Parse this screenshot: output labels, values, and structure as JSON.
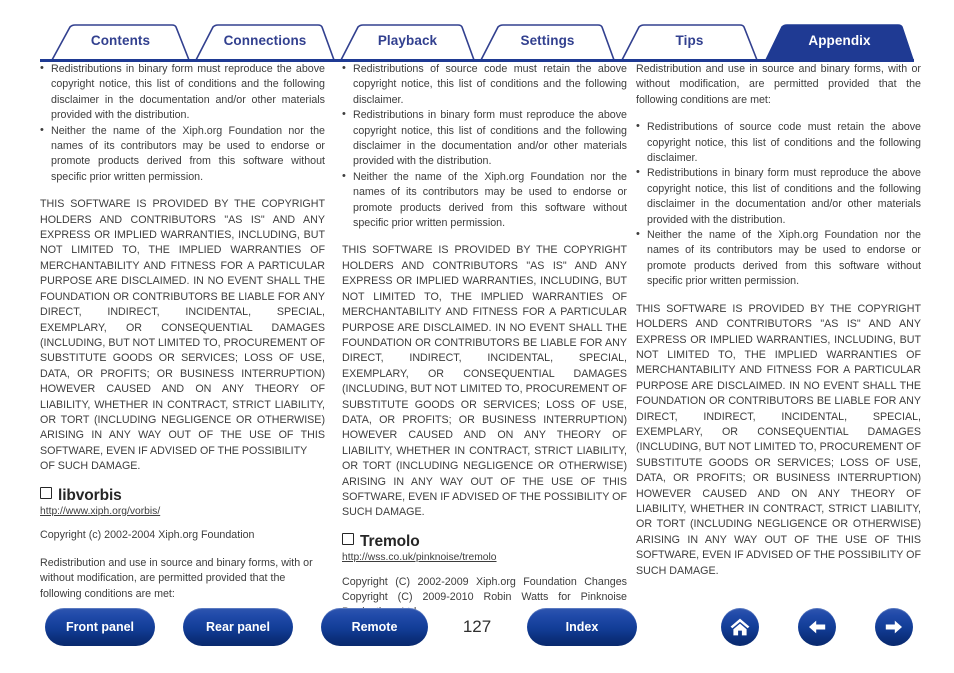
{
  "tabs": [
    {
      "label": "Contents",
      "active": false
    },
    {
      "label": "Connections",
      "active": false
    },
    {
      "label": "Playback",
      "active": false
    },
    {
      "label": "Settings",
      "active": false
    },
    {
      "label": "Tips",
      "active": false
    },
    {
      "label": "Appendix",
      "active": true
    }
  ],
  "colors": {
    "tab_text": "#32408f",
    "tab_active_bg": "#1f3a93",
    "tab_border": "#32408f",
    "button_blue": "#123d96",
    "body_text": "#3d3d3d"
  },
  "columns": {
    "col1": {
      "bullets_top": [
        "Redistributions in binary form must reproduce the above copyright notice, this list of conditions and the following disclaimer in the documentation and/or other materials provided with the distribution.",
        "Neither the name of the Xiph.org Foundation nor the names of its contributors may be used to endorse or promote products derived from this software without specific prior written permission."
      ],
      "disclaimer": "THIS SOFTWARE IS PROVIDED BY THE COPYRIGHT HOLDERS AND CONTRIBUTORS \"AS IS\" AND ANY EXPRESS OR IMPLIED WARRANTIES, INCLUDING, BUT NOT LIMITED TO, THE IMPLIED WARRANTIES OF MERCHANTABILITY AND FITNESS FOR A PARTICULAR PURPOSE ARE DISCLAIMED. IN NO EVENT SHALL THE FOUNDATION OR CONTRIBUTORS BE LIABLE FOR ANY DIRECT, INDIRECT, INCIDENTAL, SPECIAL, EXEMPLARY, OR CONSEQUENTIAL DAMAGES (INCLUDING, BUT NOT LIMITED TO, PROCUREMENT OF SUBSTITUTE GOODS OR SERVICES; LOSS OF USE, DATA, OR PROFITS; OR BUSINESS INTERRUPTION) HOWEVER CAUSED AND ON ANY THEORY OF LIABILITY, WHETHER IN CONTRACT, STRICT LIABILITY, OR TORT (INCLUDING NEGLIGENCE OR OTHERWISE) ARISING IN ANY WAY OUT OF THE USE OF THIS SOFTWARE, EVEN IF ADVISED OF THE POSSIBILITY",
      "disclaimer_tail": "OF SUCH DAMAGE.",
      "section_title": "libvorbis",
      "section_url": "http://www.xiph.org/vorbis/",
      "copyright": "Copyright (c) 2002-2004 Xiph.org Foundation",
      "redistribution": "Redistribution and use in source and binary forms, with or without modification, are permitted provided that the following conditions are met:"
    },
    "col2": {
      "bullets_top": [
        "Redistributions of source code must retain the above copyright notice, this list of conditions and the following disclaimer.",
        "Redistributions in binary form must reproduce the above copyright notice, this list of conditions and the following disclaimer in the documentation and/or other materials provided with the distribution.",
        "Neither the name of the Xiph.org Foundation nor the names of its contributors may be used to endorse or promote products derived from this software without specific prior written permission."
      ],
      "disclaimer": "THIS SOFTWARE IS PROVIDED BY THE COPYRIGHT HOLDERS AND CONTRIBUTORS \"AS IS\" AND ANY EXPRESS OR IMPLIED WARRANTIES, INCLUDING, BUT NOT LIMITED TO, THE IMPLIED WARRANTIES OF MERCHANTABILITY AND FITNESS FOR A PARTICULAR PURPOSE ARE DISCLAIMED. IN NO EVENT SHALL THE FOUNDATION OR CONTRIBUTORS BE LIABLE FOR ANY DIRECT, INDIRECT, INCIDENTAL, SPECIAL, EXEMPLARY, OR CONSEQUENTIAL DAMAGES (INCLUDING, BUT NOT LIMITED TO, PROCUREMENT OF SUBSTITUTE GOODS OR SERVICES; LOSS OF USE, DATA, OR PROFITS; OR BUSINESS INTERRUPTION) HOWEVER CAUSED AND ON ANY THEORY OF LIABILITY, WHETHER IN CONTRACT, STRICT LIABILITY, OR TORT (INCLUDING NEGLIGENCE OR OTHERWISE) ARISING IN ANY WAY OUT OF THE USE OF THIS SOFTWARE, EVEN IF ADVISED OF THE POSSIBILITY OF SUCH DAMAGE.",
      "section_title": "Tremolo",
      "section_url": "http://wss.co.uk/pinknoise/tremolo",
      "copyright": "Copyright (C) 2002-2009 Xiph.org Foundation Changes Copyright (C) 2009-2010 Robin Watts for Pinknoise Productions Ltd"
    },
    "col3": {
      "redistribution": "Redistribution and use in source and binary forms, with or without modification, are permitted provided that the following conditions are met:",
      "bullets": [
        "Redistributions of source code must retain the above copyright notice, this list of conditions and the following disclaimer.",
        "Redistributions in binary form must reproduce the above copyright notice, this list of conditions and the following disclaimer in the documentation and/or other materials provided with the distribution.",
        "Neither the name of the Xiph.org Foundation nor the names of its contributors may be used to endorse or promote products derived from this software without specific prior written permission."
      ],
      "disclaimer": "THIS SOFTWARE IS PROVIDED BY THE COPYRIGHT HOLDERS AND CONTRIBUTORS \"AS IS\" AND ANY EXPRESS OR IMPLIED WARRANTIES, INCLUDING, BUT NOT LIMITED TO, THE IMPLIED WARRANTIES OF MERCHANTABILITY AND FITNESS FOR A PARTICULAR PURPOSE ARE DISCLAIMED. IN NO EVENT SHALL THE FOUNDATION OR CONTRIBUTORS BE LIABLE FOR ANY DIRECT, INDIRECT, INCIDENTAL, SPECIAL, EXEMPLARY, OR CONSEQUENTIAL DAMAGES (INCLUDING, BUT NOT LIMITED TO, PROCUREMENT OF SUBSTITUTE GOODS OR SERVICES; LOSS OF USE, DATA, OR PROFITS; OR BUSINESS INTERRUPTION) HOWEVER CAUSED AND ON ANY THEORY OF LIABILITY, WHETHER IN CONTRACT, STRICT LIABILITY, OR TORT (INCLUDING NEGLIGENCE OR OTHERWISE) ARISING IN ANY WAY OUT OF THE USE OF THIS SOFTWARE, EVEN IF ADVISED OF THE POSSIBILITY OF SUCH DAMAGE."
    }
  },
  "footer": {
    "front_panel": "Front panel",
    "rear_panel": "Rear panel",
    "remote": "Remote",
    "index": "Index",
    "page_number": "127",
    "home_icon": "home-icon",
    "back_icon": "arrow-left-icon",
    "forward_icon": "arrow-right-icon"
  }
}
